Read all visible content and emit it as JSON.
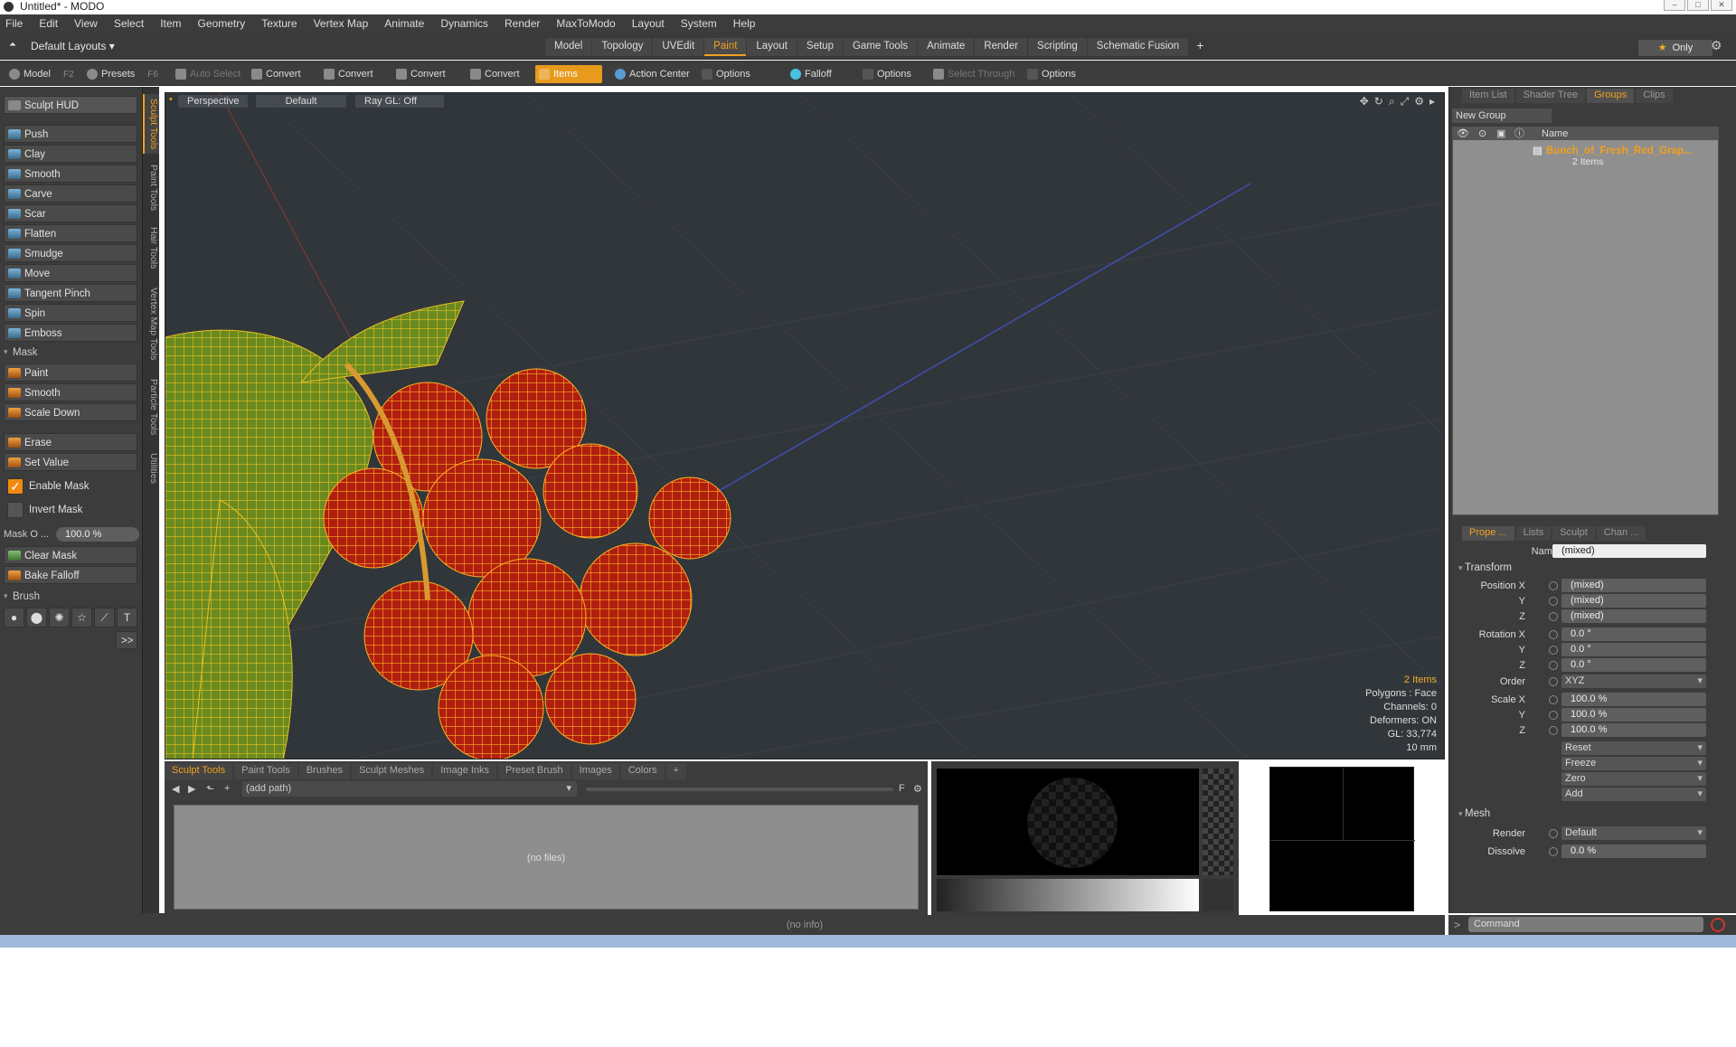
{
  "window": {
    "title": "Untitled* - MODO"
  },
  "menu": [
    "File",
    "Edit",
    "View",
    "Select",
    "Item",
    "Geometry",
    "Texture",
    "Vertex Map",
    "Animate",
    "Dynamics",
    "Render",
    "MaxToModo",
    "Layout",
    "System",
    "Help"
  ],
  "layout_selector": "Default Layouts",
  "layout_tabs": [
    "Model",
    "Topology",
    "UVEdit",
    "Paint",
    "Layout",
    "Setup",
    "Game Tools",
    "Animate",
    "Render",
    "Scripting",
    "Schematic Fusion"
  ],
  "layout_active": "Paint",
  "only_label": "Only",
  "toolbar": {
    "model": "Model",
    "model_key": "F2",
    "presets": "Presets",
    "presets_key": "F6",
    "auto_select": "Auto Select",
    "convert": "Convert",
    "items": "Items",
    "action_center": "Action Center",
    "options": "Options",
    "falloff": "Falloff",
    "select_through": "Select Through"
  },
  "left_panel": {
    "hud": "Sculpt HUD",
    "tools": [
      "Push",
      "Clay",
      "Smooth",
      "Carve",
      "Scar",
      "Flatten",
      "Smudge",
      "Move",
      "Tangent Pinch",
      "Spin",
      "Emboss"
    ],
    "mask_section": "Mask",
    "mask_tools": [
      "Paint",
      "Smooth",
      "Scale Down"
    ],
    "mask_tools2": [
      "Erase",
      "Set Value"
    ],
    "enable_mask": "Enable Mask",
    "invert_mask": "Invert Mask",
    "mask_opacity_label": "Mask O ...",
    "mask_opacity_value": "100.0 %",
    "clear_mask": "Clear Mask",
    "bake_falloff": "Bake Falloff",
    "brush_section": "Brush",
    "more": ">>"
  },
  "vertical_tabs": [
    "Sculpt Tools",
    "Paint Tools",
    "Hair Tools",
    "Vertex Map Tools",
    "Particle Tools",
    "Utilities"
  ],
  "viewport": {
    "view": "Perspective",
    "style": "Default",
    "raygl": "Ray GL: Off",
    "stats": {
      "items": "2 Items",
      "polygons": "Polygons : Face",
      "channels": "Channels: 0",
      "deformers": "Deformers: ON",
      "gl": "GL: 33,774",
      "scale": "10 mm"
    }
  },
  "bottom_panel": {
    "tabs": [
      "Sculpt Tools",
      "Paint Tools",
      "Brushes",
      "Sculpt Meshes",
      "Image Inks",
      "Preset Brush",
      "Images",
      "Colors"
    ],
    "path": "(add path)",
    "empty": "(no files)"
  },
  "status": "(no info)",
  "right_panel": {
    "tabs": [
      "Item List",
      "Shader Tree",
      "Groups",
      "Clips"
    ],
    "active_tab": "Groups",
    "new_group": "New Group",
    "name_header": "Name",
    "group_name": "Bunch_of_Fresh_Red_Grap...",
    "group_count": "2 Items",
    "prop_tabs": [
      "Prope ...",
      "Lists",
      "Sculpt",
      "Chan ..."
    ],
    "name_label": "Name",
    "name_value": "(mixed)",
    "transform": "Transform",
    "position_x_label": "Position X",
    "position": [
      "(mixed)",
      "(mixed)",
      "(mixed)"
    ],
    "rotation_x_label": "Rotation X",
    "rotation": [
      "0.0 °",
      "0.0 °",
      "0.0 °"
    ],
    "order_label": "Order",
    "order": "XYZ",
    "scale_x_label": "Scale X",
    "scale": [
      "100.0 %",
      "100.0 %",
      "100.0 %"
    ],
    "y": "Y",
    "z": "Z",
    "actions": [
      "Reset",
      "Freeze",
      "Zero",
      "Add"
    ],
    "mesh": "Mesh",
    "render_label": "Render",
    "render": "Default",
    "dissolve_label": "Dissolve",
    "dissolve": "0.0 %",
    "command": "Command"
  }
}
